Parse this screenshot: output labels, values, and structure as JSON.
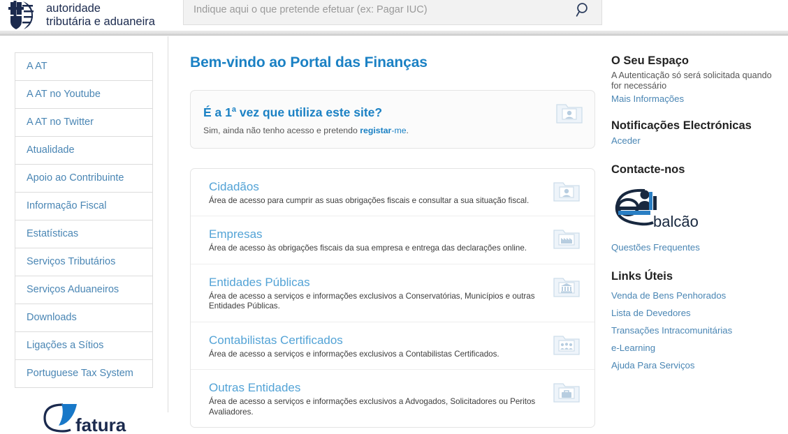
{
  "header": {
    "brand_line1": "autoridade",
    "brand_line2": "tributária e aduaneira",
    "crest_icon": "portugal-coat-of-arms-icon",
    "search": {
      "placeholder": "Indique aqui o que pretende efetuar (ex: Pagar IUC)",
      "value": "",
      "icon": "search-icon"
    }
  },
  "sidebar": {
    "items": [
      {
        "label": "A AT"
      },
      {
        "label": "A AT no Youtube"
      },
      {
        "label": "A AT no Twitter"
      },
      {
        "label": "Atualidade"
      },
      {
        "label": "Apoio ao Contribuinte"
      },
      {
        "label": "Informação Fiscal"
      },
      {
        "label": "Estatísticas"
      },
      {
        "label": "Serviços Tributários"
      },
      {
        "label": "Serviços Aduaneiros"
      },
      {
        "label": "Downloads"
      },
      {
        "label": "Ligações a Sítios"
      },
      {
        "label": "Portuguese Tax System"
      }
    ],
    "fatura_logo": "e-fatura-logo",
    "fatura_text": "fatura"
  },
  "main": {
    "welcome_title": "Bem-vindo ao Portal das Finanças",
    "first_time": {
      "title_pre": "É a 1",
      "title_sup": "a",
      "title_post": " vez que utiliza este site?",
      "subtitle_pre": "Sim, ainda não tenho acesso e pretendo ",
      "subtitle_link": "registar",
      "subtitle_link_tail": "-me",
      "subtitle_post": ".",
      "icon": "user-folder-icon"
    },
    "cards": [
      {
        "title": "Cidadãos",
        "description": "Área de acesso para cumprir as suas obrigações fiscais e consultar a sua situação fiscal.",
        "icon": "user-folder-icon"
      },
      {
        "title": "Empresas",
        "description": "Área de acesso às obrigações fiscais da sua empresa e entrega das declarações online.",
        "icon": "factory-folder-icon"
      },
      {
        "title": "Entidades Públicas",
        "description": "Área de acesso a serviços e informações exclusivos a Conservatórias, Municípios e outras Entidades Públicas.",
        "icon": "bank-folder-icon"
      },
      {
        "title": "Contabilistas Certificados",
        "description": "Área de acesso a serviços e informações exclusivos a Contabilistas Certificados.",
        "icon": "people-folder-icon"
      },
      {
        "title": "Outras Entidades",
        "description": "Área de acesso a serviços e informações exclusivos a Advogados, Solicitadores ou Peritos Avaliadores.",
        "icon": "briefcase-folder-icon"
      }
    ]
  },
  "rightbar": {
    "espaco": {
      "title": "O Seu Espaço",
      "subtitle": "A Autenticação só será solicitada quando for necessário",
      "link": "Mais Informações"
    },
    "notificacoes": {
      "title": "Notificações Electrónicas",
      "link": "Aceder"
    },
    "contacte": {
      "title": "Contacte-nos",
      "logo_icon": "e-balcao-logo",
      "logo_text": "balcão",
      "link": "Questões Frequentes"
    },
    "links_uteis": {
      "title": "Links Úteis",
      "items": [
        {
          "label": "Venda de Bens Penhorados"
        },
        {
          "label": "Lista de Devedores"
        },
        {
          "label": "Transações Intracomunitárias"
        },
        {
          "label": "e-Learning"
        },
        {
          "label": "Ajuda Para Serviços"
        }
      ]
    }
  },
  "colors": {
    "brand_navy": "#1b2a4e",
    "heading_blue": "#1b81c4",
    "link_blue": "#4a86b4",
    "card_title_blue": "#53a3d6",
    "border_gray": "#dcdcdc"
  }
}
